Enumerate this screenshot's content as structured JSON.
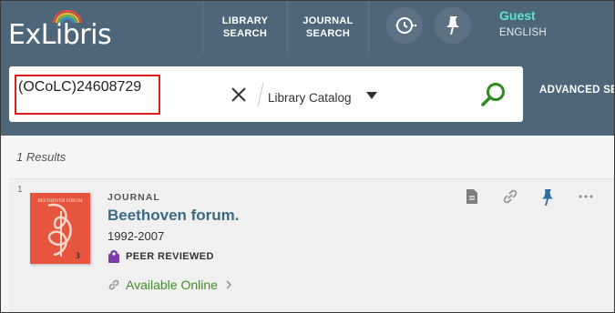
{
  "header": {
    "logo_text": "ExLibris",
    "nav": [
      {
        "label": "LIBRARY\nSEARCH"
      },
      {
        "label": "JOURNAL\nSEARCH"
      }
    ],
    "user": {
      "name": "Guest",
      "language": "ENGLISH"
    }
  },
  "search": {
    "query": "(OCoLC)24608729",
    "scope": "Library Catalog",
    "advanced_label": "ADVANCED SE"
  },
  "results": {
    "count_label": "1 Results",
    "items": [
      {
        "index": "1",
        "type": "JOURNAL",
        "title": "Beethoven forum.",
        "date": "1992-2007",
        "peer_reviewed_label": "PEER REVIEWED",
        "availability": "Available Online",
        "cover_text": "BEETHOVEN FORUM",
        "cover_volume": "3"
      }
    ]
  },
  "colors": {
    "header_bg": "#4e6679",
    "accent_teal": "#5fe0d0",
    "title_link": "#3d6985",
    "available_green": "#3f8f2a",
    "highlight_red": "#e01b1b",
    "search_icon_green": "#2e8a1f",
    "pin_blue": "#2d6e9c",
    "peer_purple": "#7a3ea8"
  },
  "icons": [
    "history-icon",
    "pin-icon",
    "close-icon",
    "chevron-down-icon",
    "search-icon",
    "citation-icon",
    "link-icon",
    "pin-icon",
    "more-icon",
    "peer-reviewed-icon",
    "link-icon",
    "chevron-right-icon"
  ]
}
